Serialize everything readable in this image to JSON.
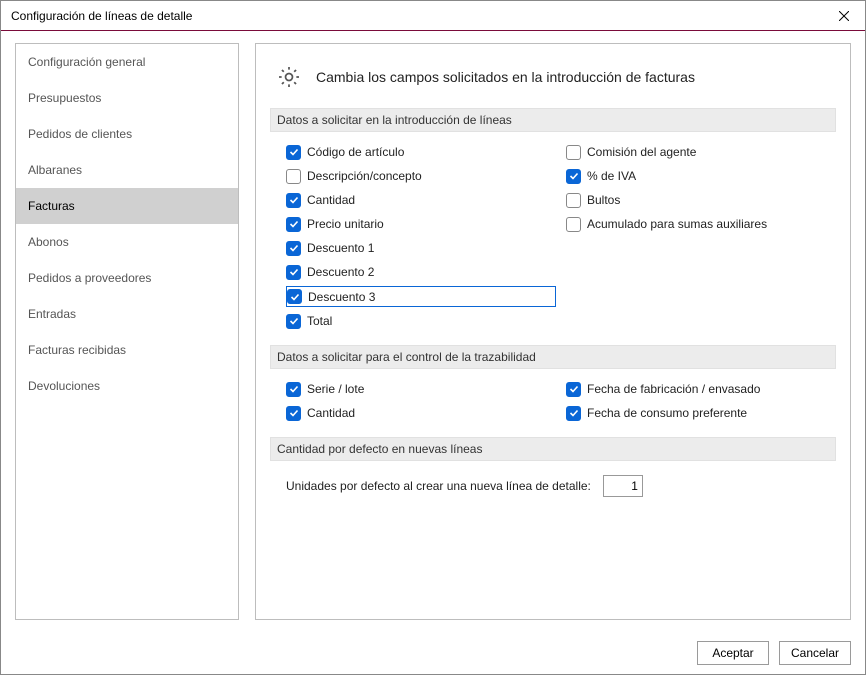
{
  "window": {
    "title": "Configuración de líneas de detalle"
  },
  "sidebar": {
    "items": [
      {
        "label": "Configuración general"
      },
      {
        "label": "Presupuestos"
      },
      {
        "label": "Pedidos de clientes"
      },
      {
        "label": "Albaranes"
      },
      {
        "label": "Facturas"
      },
      {
        "label": "Abonos"
      },
      {
        "label": "Pedidos a proveedores"
      },
      {
        "label": "Entradas"
      },
      {
        "label": "Facturas recibidas"
      },
      {
        "label": "Devoluciones"
      }
    ],
    "selected": 4
  },
  "content": {
    "heading": "Cambia los campos solicitados en la introducción de facturas",
    "section1": {
      "title": "Datos a solicitar en la introducción de líneas",
      "left": [
        {
          "label": "Código de artículo",
          "checked": true
        },
        {
          "label": "Descripción/concepto",
          "checked": false
        },
        {
          "label": "Cantidad",
          "checked": true
        },
        {
          "label": "Precio unitario",
          "checked": true
        },
        {
          "label": "Descuento 1",
          "checked": true
        },
        {
          "label": "Descuento 2",
          "checked": true
        },
        {
          "label": "Descuento 3",
          "checked": true,
          "highlight": true
        },
        {
          "label": "Total",
          "checked": true
        }
      ],
      "right": [
        {
          "label": "Comisión del agente",
          "checked": false
        },
        {
          "label": "% de IVA",
          "checked": true
        },
        {
          "label": "Bultos",
          "checked": false
        },
        {
          "label": "Acumulado para sumas auxiliares",
          "checked": false
        }
      ]
    },
    "section2": {
      "title": "Datos a solicitar para el control de la trazabilidad",
      "left": [
        {
          "label": "Serie / lote",
          "checked": true
        },
        {
          "label": "Cantidad",
          "checked": true
        }
      ],
      "right": [
        {
          "label": "Fecha de fabricación / envasado",
          "checked": true
        },
        {
          "label": "Fecha de consumo preferente",
          "checked": true
        }
      ]
    },
    "section3": {
      "title": "Cantidad por defecto en nuevas líneas",
      "label": "Unidades por defecto al crear una nueva línea de detalle:",
      "value": "1"
    }
  },
  "footer": {
    "accept": "Aceptar",
    "cancel": "Cancelar"
  }
}
